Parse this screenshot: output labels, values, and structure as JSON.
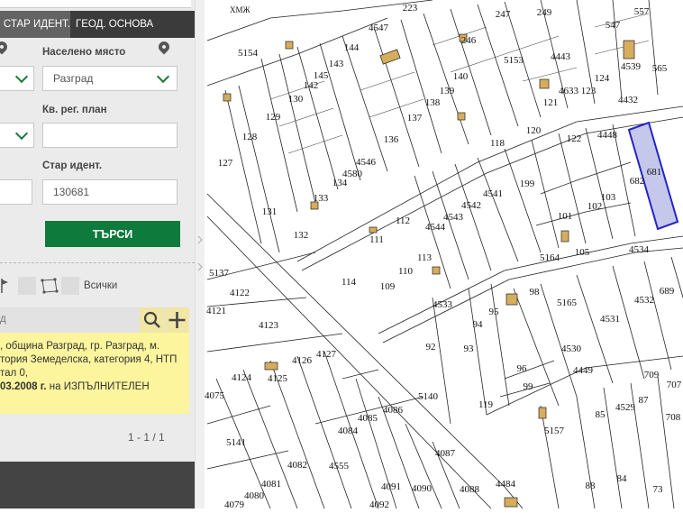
{
  "tabs": [
    "СТАР ИДЕНТ.",
    "ГЕОД. ОСНОВА"
  ],
  "form": {
    "settlement_label": "Населено място",
    "settlement_value": "Разград",
    "reg_plan_label": "Кв. рег. план",
    "reg_plan_value": "",
    "old_id_label": "Стар идент.",
    "old_id_value": "130681",
    "search_button": "ТЪРСИ"
  },
  "tools": {
    "all_label": "Всички"
  },
  "searchbar": {
    "text": "д"
  },
  "result": {
    "line1": ", община Разград, гр. Разград, м.",
    "line2": "тория Земеделска, категория 4, НТП",
    "line3": "тал 0,",
    "line4_bold": "03.2008 г.",
    "line4_rest": " на ИЗПЪЛНИТЕЛЕН"
  },
  "pager": "1 - 1 / 1",
  "map": {
    "top_label": "ХМЖ",
    "parcels": [
      [
        "223",
        455,
        12
      ],
      [
        "247",
        558,
        19
      ],
      [
        "249",
        604,
        17
      ],
      [
        "557",
        712,
        16
      ],
      [
        "4547",
        420,
        34
      ],
      [
        "246",
        520,
        48
      ],
      [
        "5154",
        275,
        62
      ],
      [
        "144",
        390,
        56
      ],
      [
        "5153",
        570,
        70
      ],
      [
        "4443",
        622,
        66
      ],
      [
        "547",
        680,
        31
      ],
      [
        "4539",
        700,
        77
      ],
      [
        "565",
        732,
        79
      ],
      [
        "145",
        356,
        87
      ],
      [
        "143",
        373,
        74
      ],
      [
        "140",
        511,
        88
      ],
      [
        "142",
        345,
        98
      ],
      [
        "130",
        328,
        113
      ],
      [
        "139",
        496,
        104
      ],
      [
        "138",
        480,
        117
      ],
      [
        "121",
        611,
        117
      ],
      [
        "4633",
        631,
        104
      ],
      [
        "123",
        653,
        104
      ],
      [
        "124",
        668,
        90
      ],
      [
        "4432",
        697,
        114
      ],
      [
        "129",
        303,
        133
      ],
      [
        "137",
        460,
        134
      ],
      [
        "120",
        592,
        148
      ],
      [
        "122",
        637,
        157
      ],
      [
        "4448",
        674,
        153
      ],
      [
        "136",
        434,
        158
      ],
      [
        "118",
        552,
        162
      ],
      [
        "128",
        277,
        155
      ],
      [
        "4546",
        406,
        183
      ],
      [
        "681",
        726,
        194
      ],
      [
        "127",
        250,
        184
      ],
      [
        "4580",
        391,
        196
      ],
      [
        "134",
        377,
        206
      ],
      [
        "199",
        585,
        207
      ],
      [
        "682",
        707,
        204
      ],
      [
        "4541",
        547,
        218
      ],
      [
        "133",
        356,
        223
      ],
      [
        "4542",
        523,
        231
      ],
      [
        "103",
        675,
        222
      ],
      [
        "102",
        660,
        232
      ],
      [
        "131",
        299,
        238
      ],
      [
        "4543",
        503,
        244
      ],
      [
        "101",
        627,
        243
      ],
      [
        "112",
        447,
        248
      ],
      [
        "4544",
        483,
        255
      ],
      [
        "132",
        334,
        264
      ],
      [
        "111",
        418,
        269
      ],
      [
        "105",
        646,
        283
      ],
      [
        "4534",
        709,
        280
      ],
      [
        "5164",
        610,
        289
      ],
      [
        "113",
        471,
        289
      ],
      [
        "5137",
        243,
        306
      ],
      [
        "110",
        450,
        304
      ],
      [
        "114",
        387,
        316
      ],
      [
        "109",
        430,
        321
      ],
      [
        "689",
        740,
        326
      ],
      [
        "4122",
        266,
        328
      ],
      [
        "98",
        593,
        327
      ],
      [
        "4533",
        491,
        341
      ],
      [
        "5165",
        629,
        339
      ],
      [
        "4532",
        715,
        336
      ],
      [
        "95",
        548,
        349
      ],
      [
        "4121",
        240,
        348
      ],
      [
        "94",
        530,
        363
      ],
      [
        "4531",
        677,
        357
      ],
      [
        "4123",
        298,
        364
      ],
      [
        "92",
        478,
        388
      ],
      [
        "93",
        520,
        390
      ],
      [
        "4127",
        362,
        396
      ],
      [
        "4530",
        634,
        390
      ],
      [
        "4126",
        335,
        403
      ],
      [
        "96",
        579,
        412
      ],
      [
        "4449",
        647,
        414
      ],
      [
        "709",
        723,
        419
      ],
      [
        "707",
        748,
        430
      ],
      [
        "4124",
        268,
        422
      ],
      [
        "4125",
        308,
        423
      ],
      [
        "99",
        586,
        432
      ],
      [
        "87",
        714,
        447
      ],
      [
        "5140",
        475,
        443
      ],
      [
        "4075",
        238,
        442
      ],
      [
        "119",
        539,
        452
      ],
      [
        "4529",
        694,
        455
      ],
      [
        "85",
        666,
        463
      ],
      [
        "4085",
        408,
        467
      ],
      [
        "4086",
        436,
        458
      ],
      [
        "708",
        747,
        466
      ],
      [
        "4084",
        386,
        481
      ],
      [
        "5157",
        615,
        481
      ],
      [
        "5141",
        262,
        494
      ],
      [
        "4087",
        494,
        506
      ],
      [
        "4082",
        330,
        519
      ],
      [
        "4555",
        376,
        520
      ],
      [
        "84",
        690,
        534
      ],
      [
        "4081",
        301,
        540
      ],
      [
        "4091",
        434,
        543
      ],
      [
        "4090",
        468,
        545
      ],
      [
        "4088",
        521,
        546
      ],
      [
        "4484",
        561,
        540
      ],
      [
        "88",
        655,
        542
      ],
      [
        "73",
        730,
        546
      ],
      [
        "4080",
        282,
        553
      ],
      [
        "4079",
        260,
        563
      ],
      [
        "4092",
        421,
        563
      ]
    ]
  }
}
